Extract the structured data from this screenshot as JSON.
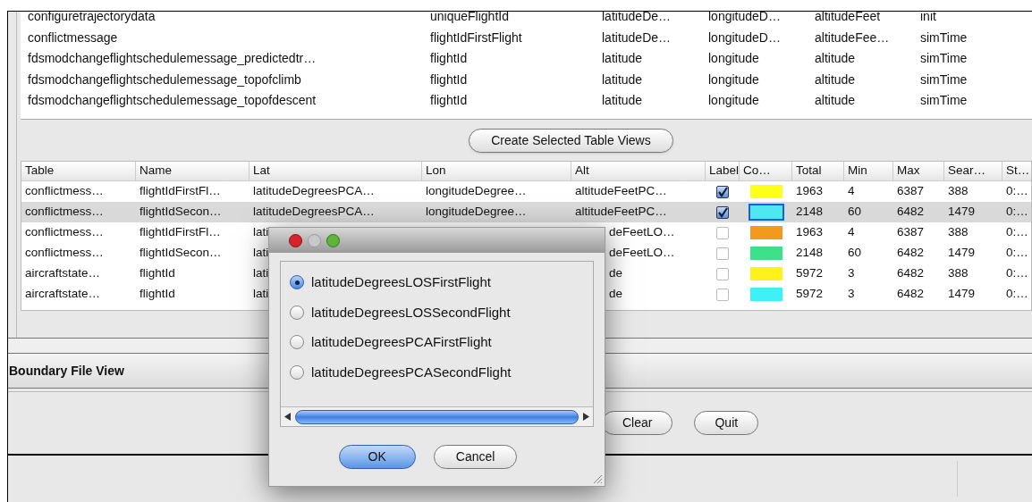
{
  "source_table": {
    "rows": [
      {
        "table": "configuretrajectorydata",
        "name": "uniqueFlightId",
        "lat": "latitudeDe…",
        "lon": "longitudeD…",
        "alt": "altitudeFeet",
        "time": "init"
      },
      {
        "table": "conflictmessage",
        "name": "flightIdFirstFlight",
        "lat": "latitudeDe…",
        "lon": "longitudeD…",
        "alt": "altitudeFee…",
        "time": "simTime"
      },
      {
        "table": "fdsmodchangeflightschedulemessage_predictedtr…",
        "name": "flightId",
        "lat": "latitude",
        "lon": "longitude",
        "alt": "altitude",
        "time": "simTime"
      },
      {
        "table": "fdsmodchangeflightschedulemessage_topofclimb",
        "name": "flightId",
        "lat": "latitude",
        "lon": "longitude",
        "alt": "altitude",
        "time": "simTime"
      },
      {
        "table": "fdsmodchangeflightschedulemessage_topofdescent",
        "name": "flightId",
        "lat": "latitude",
        "lon": "longitude",
        "alt": "altitude",
        "time": "simTime"
      }
    ]
  },
  "create_button": "Create Selected Table Views",
  "views_table": {
    "columns": [
      "Table",
      "Name",
      "Lat",
      "Lon",
      "Alt",
      "Label",
      "Co…",
      "Total",
      "Min",
      "Max",
      "Sear…",
      "St…"
    ],
    "rows": [
      {
        "table": "conflictmess…",
        "name": "flightIdFirstFl…",
        "lat": "latitudeDegreesPCA…",
        "lon": "longitudeDegree…",
        "alt": "altitudeFeetPC…",
        "label": true,
        "color": "#ffff1a",
        "total": "1963",
        "min": "4",
        "max": "6387",
        "search": "388",
        "start": "0:…",
        "selected": false
      },
      {
        "table": "conflictmess…",
        "name": "flightIdSecon…",
        "lat": "latitudeDegreesPCA…",
        "lon": "longitudeDegree…",
        "alt": "altitudeFeetPC…",
        "label": true,
        "color": "#4ee8f0",
        "total": "2148",
        "min": "60",
        "max": "6482",
        "search": "1479",
        "start": "0:…",
        "selected": true
      },
      {
        "table": "conflictmess…",
        "name": "flightIdFirstFl…",
        "lat": "lati",
        "alt": "deFeetLO…",
        "label": false,
        "color": "#f39a1e",
        "total": "1963",
        "min": "4",
        "max": "6387",
        "search": "388",
        "start": "0:…",
        "selected": false
      },
      {
        "table": "conflictmess…",
        "name": "flightIdSecon…",
        "lat": "lati",
        "alt": "deFeetLO…",
        "label": false,
        "color": "#3ee08a",
        "total": "2148",
        "min": "60",
        "max": "6482",
        "search": "1479",
        "start": "0:…",
        "selected": false
      },
      {
        "table": "aircraftstate…",
        "name": "flightId",
        "lat": "lati",
        "alt": "de",
        "label": false,
        "color": "#fff21a",
        "total": "5972",
        "min": "3",
        "max": "6482",
        "search": "388",
        "start": "0:…",
        "selected": false
      },
      {
        "table": "aircraftstate…",
        "name": "flightId",
        "lat": "lati",
        "alt": "de",
        "label": false,
        "color": "#3ef0f8",
        "total": "5972",
        "min": "3",
        "max": "6482",
        "search": "1479",
        "start": "0:…",
        "selected": false
      }
    ]
  },
  "boundary_panel": {
    "title": "Boundary File View"
  },
  "buttons": [
    "Clear",
    "Quit"
  ],
  "dialog": {
    "options": [
      {
        "label": "latitudeDegreesLOSFirstFlight",
        "selected": true
      },
      {
        "label": "latitudeDegreesLOSSecondFlight",
        "selected": false
      },
      {
        "label": "latitudeDegreesPCAFirstFlight",
        "selected": false
      },
      {
        "label": "latitudeDegreesPCASecondFlight",
        "selected": false
      }
    ],
    "buttons": [
      {
        "label": "OK",
        "default": true
      },
      {
        "label": "Cancel",
        "default": false
      }
    ]
  }
}
